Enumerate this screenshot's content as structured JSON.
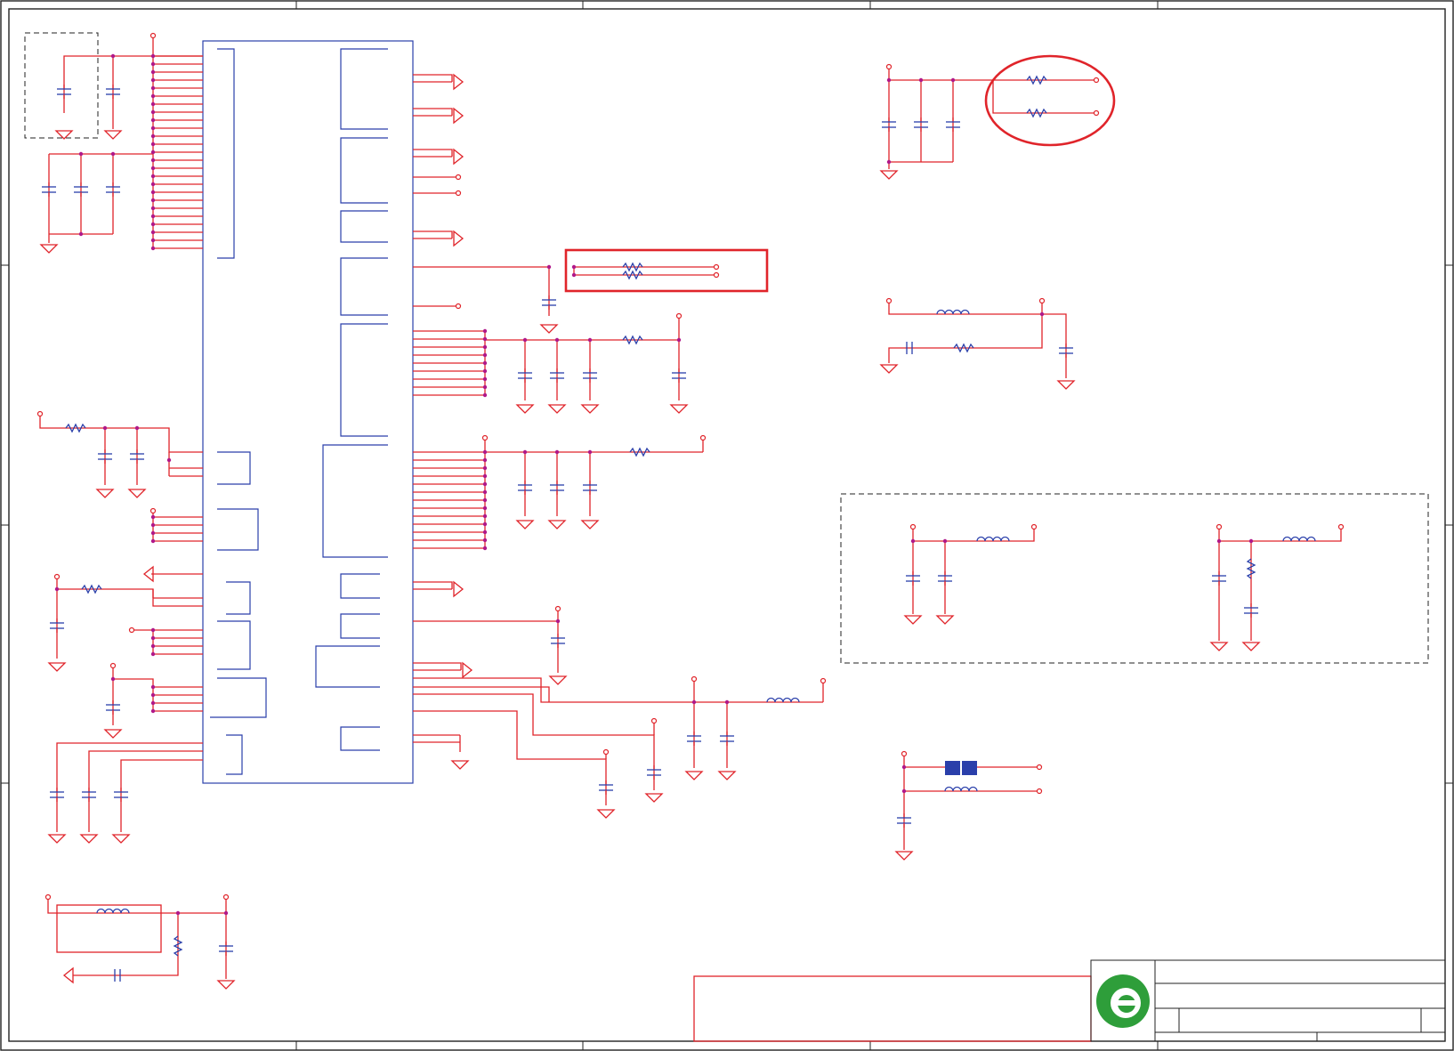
{
  "colors": {
    "wire": "#e0242a",
    "component": "#2a3faa",
    "junction": "#b0188a",
    "highlight": "#e0242a",
    "logo_outer": "#2e9e3a",
    "logo_inner": "#ffffff"
  },
  "icons": {
    "logo": "company-logo-icon"
  }
}
